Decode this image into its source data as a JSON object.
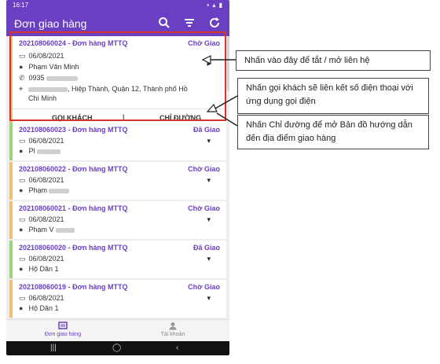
{
  "status_bar": {
    "time": "16:17"
  },
  "app_bar": {
    "title": "Đơn giao hàng",
    "icons": [
      "search-icon",
      "filter-icon",
      "refresh-icon"
    ]
  },
  "orders": [
    {
      "id": "202108060024 - Đơn hàng MTTQ",
      "status": "Chờ Giao",
      "date": "06/08/2021",
      "customer": "Phạm Văn Minh",
      "phone": "0935",
      "address_end": ", Hiệp Thành, Quận 12, Thành phố Hồ",
      "address_line2": "Chí Minh",
      "call_label": "GỌI KHÁCH",
      "sep": "|",
      "route_label": "CHỈ ĐƯỜNG"
    },
    {
      "id": "202108060023 - Đơn hàng MTTQ",
      "status": "Đã Giao",
      "date": "06/08/2021",
      "customer": "Pl"
    },
    {
      "id": "202108060022 - Đơn hàng MTTQ",
      "status": "Chờ Giao",
      "date": "06/08/2021",
      "customer": "Phạm"
    },
    {
      "id": "202108060021 - Đơn hàng MTTQ",
      "status": "Chờ Giao",
      "date": "06/08/2021",
      "customer": "Phạm V"
    },
    {
      "id": "202108060020 - Đơn hàng MTTQ",
      "status": "Đã Giao",
      "date": "06/08/2021",
      "customer": "Hộ Dân 1"
    },
    {
      "id": "202108060019 - Đơn hàng MTTQ",
      "status": "Chờ Giao",
      "date": "06/08/2021",
      "customer": "Hộ Dân 1"
    }
  ],
  "bottom_nav": {
    "orders_label": "Đơn giao hàng",
    "account_label": "Tài khoản"
  },
  "callouts": {
    "toggle": "Nhấn vào đây để tắt / mở liên hệ",
    "call": "Nhấn gọi khách sẽ liên kết số điện thoại với ứng dụng gọi điện",
    "route": "Nhấn Chỉ đường để mở Bản đồ hướng dẫn đến địa điểm giao hàng"
  },
  "colors": {
    "primary": "#6a3fc2",
    "highlight": "#d9322b",
    "pending_bar": "#f0c070",
    "delivered_bar": "#9ad37a"
  }
}
